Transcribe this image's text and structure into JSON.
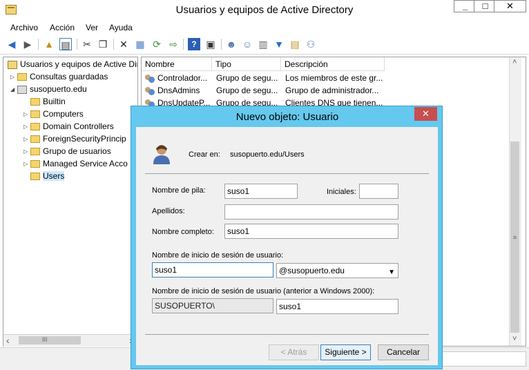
{
  "window": {
    "title": "Usuarios y equipos de Active Directory",
    "min_glyph": "_",
    "max_glyph": "□",
    "close_glyph": "✕"
  },
  "menu": [
    "Archivo",
    "Acción",
    "Ver",
    "Ayuda"
  ],
  "toolbar_icons": [
    "back-arrow-icon",
    "forward-arrow-icon",
    "up-folder-icon",
    "show-tree-icon",
    "cut-icon",
    "copy-icon",
    "delete-icon",
    "properties-icon",
    "refresh-icon",
    "export-list-icon",
    "help-icon",
    "mmc-console-icon",
    "new-user-icon",
    "new-group-icon",
    "new-ou-icon",
    "filter-icon",
    "find-icon",
    "add-to-group-icon"
  ],
  "tree": {
    "root": "Usuarios y equipos de Active Dir",
    "saved_queries": "Consultas guardadas",
    "domain": "susopuerto.edu",
    "children": [
      "Builtin",
      "Computers",
      "Domain Controllers",
      "ForeignSecurityPrincip",
      "Grupo de usuarios",
      "Managed Service Acco",
      "Users"
    ]
  },
  "list": {
    "columns": [
      "Nombre",
      "Tipo",
      "Descripción"
    ],
    "rows": [
      [
        "Controlador...",
        "Grupo de segu...",
        "Los miembros de este gr..."
      ],
      [
        "DnsAdmins",
        "Grupo de segu...",
        "Grupo de administrador..."
      ],
      [
        "DnsUpdateP...",
        "Grupo de segu...",
        "Clientes DNS que tienen..."
      ]
    ]
  },
  "scroll": {
    "h_left": "‹",
    "h_grip": "III",
    "h_right": "›",
    "v_up": "˄",
    "v_grip": "≡",
    "v_down": "˅"
  },
  "dialog": {
    "title": "Nuevo objeto: Usuario",
    "close_glyph": "✕",
    "create_in_label": "Crear en:",
    "create_in_value": "susopuerto.edu/Users",
    "first_name_label": "Nombre de pila:",
    "first_name_value": "suso1",
    "initials_label": "Iniciales:",
    "initials_value": "",
    "last_name_label": "Apellidos:",
    "last_name_value": "",
    "full_name_label": "Nombre completo:",
    "full_name_value": "suso1",
    "logon_label": "Nombre de inicio de sesión de usuario:",
    "logon_value": "suso1",
    "domain_suffix": "@susopuerto.edu",
    "pre2000_label": "Nombre de inicio de sesión de usuario (anterior a Windows 2000):",
    "pre2000_domain": "SUSOPUERTO\\",
    "pre2000_value": "suso1",
    "back_button": "< Atrás",
    "next_button": "Siguiente >",
    "cancel_button": "Cancelar"
  }
}
